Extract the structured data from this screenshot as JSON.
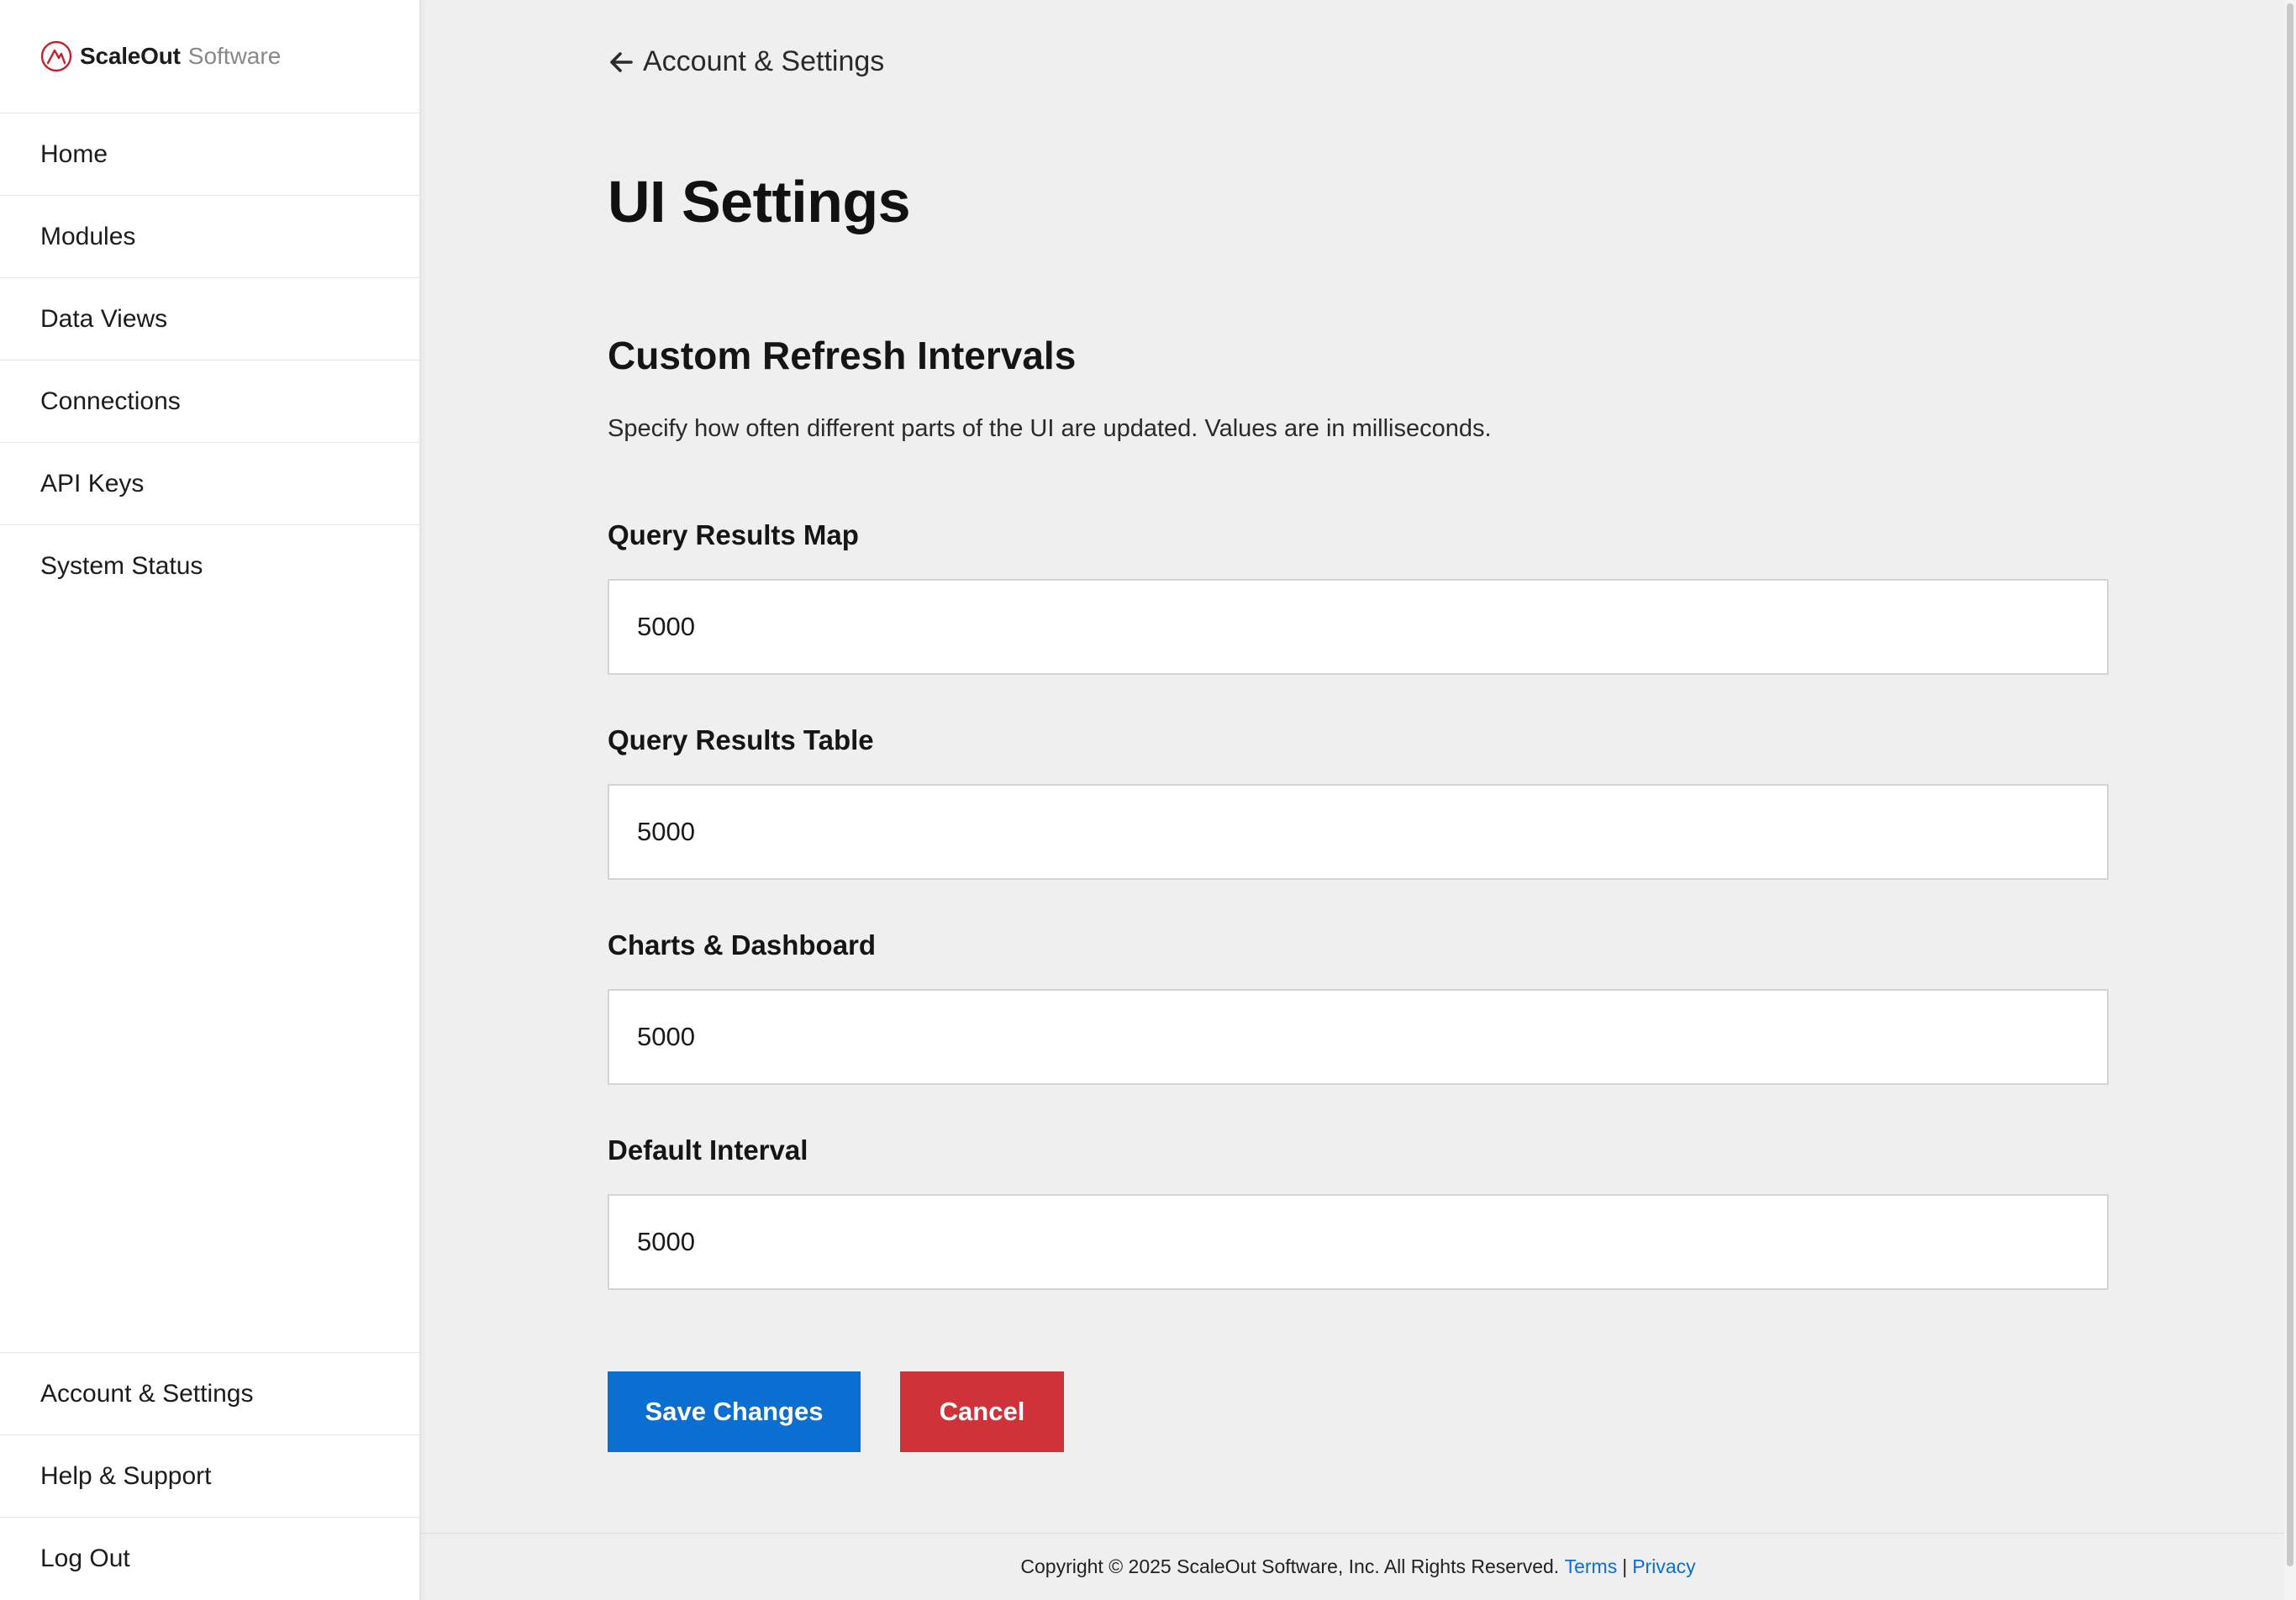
{
  "brand": {
    "name": "ScaleOut",
    "sub": "Software"
  },
  "sidebar": {
    "items": [
      {
        "label": "Home"
      },
      {
        "label": "Modules"
      },
      {
        "label": "Data Views"
      },
      {
        "label": "Connections"
      },
      {
        "label": "API Keys"
      },
      {
        "label": "System Status"
      }
    ],
    "bottom_items": [
      {
        "label": "Account & Settings"
      },
      {
        "label": "Help & Support"
      },
      {
        "label": "Log Out"
      }
    ]
  },
  "header": {
    "back_label": "Account & Settings",
    "title": "UI Settings"
  },
  "section": {
    "title": "Custom Refresh Intervals",
    "description": "Specify how often different parts of the UI are updated. Values are in milliseconds."
  },
  "fields": [
    {
      "label": "Query Results Map",
      "value": "5000"
    },
    {
      "label": "Query Results Table",
      "value": "5000"
    },
    {
      "label": "Charts & Dashboard",
      "value": "5000"
    },
    {
      "label": "Default Interval",
      "value": "5000"
    }
  ],
  "actions": {
    "save_label": "Save Changes",
    "cancel_label": "Cancel"
  },
  "footer": {
    "copyright": "Copyright © 2025 ScaleOut Software, Inc. All Rights Reserved.",
    "terms": "Terms",
    "separator": "|",
    "privacy": "Privacy"
  },
  "colors": {
    "primary": "#0a6fd1",
    "danger": "#d0323a",
    "logo": "#c8202f",
    "background": "#efefef"
  }
}
